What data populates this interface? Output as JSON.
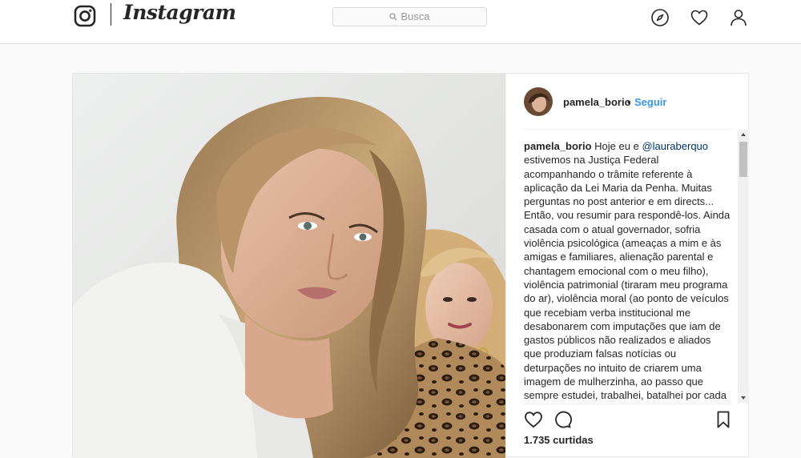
{
  "nav": {
    "wordmark": "Instagram",
    "search_placeholder": "Busca",
    "icons": [
      "instagram-glyph-icon",
      "search-icon",
      "compass-icon",
      "heart-icon",
      "person-icon"
    ]
  },
  "post": {
    "username": "pamela_borio",
    "separator": "•",
    "follow_label": "Seguir",
    "caption_user": "pamela_borio",
    "caption_text_before_mention": "Hoje eu e",
    "mention": "@lauraberquo",
    "caption_text": "estivemos na Justiça Federal acompanhando o trâmite referente à aplicação da Lei Maria da Penha. Muitas perguntas no post anterior e em directs... Então, vou resumir para respondê-los. Ainda casada com o atual governador, sofria violência psicológica (ameaças a mim e às amigas e familiares, alienação parental e chantagem emocional com o meu filho), violência patrimonial (tiraram meu programa do ar), violência moral (ao ponto de veículos que recebiam verba institucional me desabonarem com imputações que iam de gastos públicos não realizados e aliados que produziam falsas notícias ou deturpações no intuito de criarem uma imagem de mulherzinha, ao passo que sempre estudei, trabalhei, batalhei por cada conquista em uma",
    "likes": "1.735 curtidas",
    "action_icons": [
      "heart-icon",
      "comment-icon",
      "bookmark-icon"
    ]
  },
  "colors": {
    "link_blue": "#3897f0",
    "mention_blue": "#003569",
    "text": "#262626",
    "border": "#dbdbdb"
  }
}
